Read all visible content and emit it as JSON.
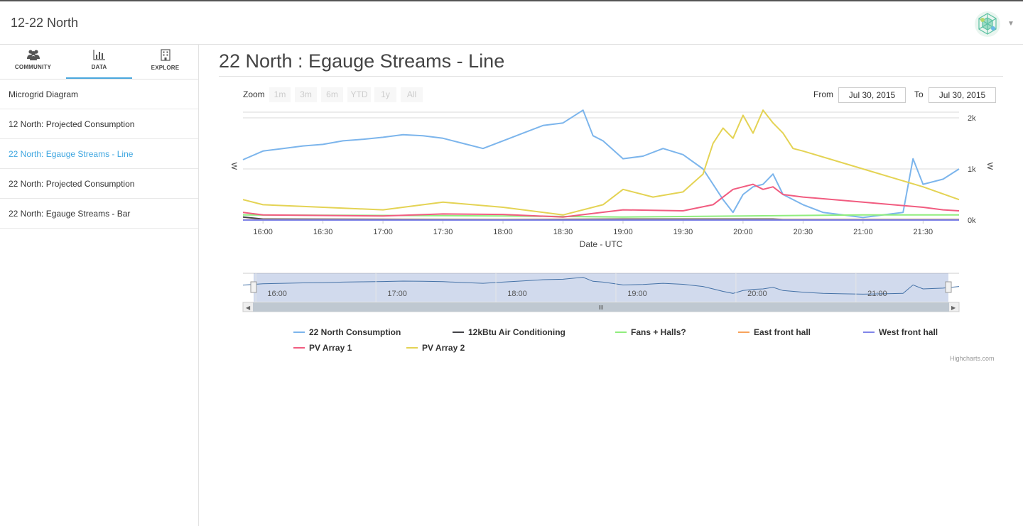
{
  "app": {
    "title": "12-22 North"
  },
  "tabs": [
    {
      "label": "COMMUNITY",
      "icon": "community-icon"
    },
    {
      "label": "DATA",
      "icon": "bar-chart-icon"
    },
    {
      "label": "EXPLORE",
      "icon": "building-icon"
    }
  ],
  "nav": [
    {
      "label": "Microgrid Diagram"
    },
    {
      "label": "12 North: Projected Consumption"
    },
    {
      "label": "22 North: Egauge Streams - Line"
    },
    {
      "label": "22 North: Projected Consumption"
    },
    {
      "label": "22 North: Egauge Streams - Bar"
    }
  ],
  "page": {
    "title": "22 North : Egauge Streams - Line"
  },
  "range_selector": {
    "zoom_label": "Zoom",
    "buttons": [
      "1m",
      "3m",
      "6m",
      "YTD",
      "1y",
      "All"
    ],
    "from_label": "From",
    "from_value": "Jul 30, 2015",
    "to_label": "To",
    "to_value": "Jul 30, 2015"
  },
  "credits": "Highcharts.com",
  "colors": {
    "consumption": "#7cb5ec",
    "ac": "#434348",
    "fans": "#90ed7d",
    "east": "#f7a35c",
    "west": "#8085e9",
    "pv1": "#f15c80",
    "pv2": "#e4d354",
    "accent": "#3ea6e0"
  },
  "chart_data": {
    "type": "line",
    "xlabel": "Date - UTC",
    "ylabel_left": "W",
    "ylabel_right": "W",
    "x_ticks": [
      "16:00",
      "16:30",
      "17:00",
      "17:30",
      "18:00",
      "18:30",
      "19:00",
      "19:30",
      "20:00",
      "20:30",
      "21:00",
      "21:30"
    ],
    "y_ticks": [
      "0k",
      "1k",
      "2k"
    ],
    "ylim": [
      0,
      2000
    ],
    "xlim": [
      "15:50",
      "21:48"
    ],
    "navigator_ticks": [
      "16:00",
      "17:00",
      "18:00",
      "19:00",
      "20:00",
      "21:00"
    ],
    "series": [
      {
        "name": "22 North Consumption",
        "color": "#7cb5ec",
        "x": [
          "15:50",
          "16:00",
          "16:10",
          "16:20",
          "16:30",
          "16:40",
          "16:50",
          "17:00",
          "17:10",
          "17:20",
          "17:30",
          "17:40",
          "17:50",
          "18:00",
          "18:10",
          "18:20",
          "18:30",
          "18:40",
          "18:45",
          "18:50",
          "19:00",
          "19:10",
          "19:20",
          "19:30",
          "19:40",
          "19:45",
          "19:50",
          "19:55",
          "20:00",
          "20:05",
          "20:10",
          "20:15",
          "20:20",
          "20:30",
          "20:40",
          "20:50",
          "21:00",
          "21:10",
          "21:20",
          "21:25",
          "21:30",
          "21:40",
          "21:48"
        ],
        "values": [
          1180,
          1350,
          1400,
          1450,
          1480,
          1550,
          1580,
          1620,
          1670,
          1650,
          1600,
          1500,
          1400,
          1550,
          1700,
          1850,
          1900,
          2150,
          1650,
          1550,
          1200,
          1250,
          1400,
          1280,
          1000,
          700,
          400,
          150,
          500,
          650,
          700,
          900,
          500,
          300,
          150,
          100,
          50,
          100,
          150,
          1200,
          700,
          800,
          1000
        ]
      },
      {
        "name": "12kBtu Air Conditioning",
        "color": "#434348",
        "x": [
          "15:50",
          "16:00",
          "18:00",
          "19:00",
          "20:15",
          "20:20",
          "21:48"
        ],
        "values": [
          60,
          20,
          10,
          20,
          20,
          10,
          10
        ]
      },
      {
        "name": "Fans + Halls?",
        "color": "#90ed7d",
        "x": [
          "15:50",
          "17:00",
          "18:00",
          "19:00",
          "20:00",
          "21:00",
          "21:48"
        ],
        "values": [
          100,
          90,
          80,
          60,
          80,
          100,
          100
        ]
      },
      {
        "name": "East front hall",
        "color": "#f7a35c",
        "x": [
          "15:50",
          "21:48"
        ],
        "values": [
          5,
          5
        ]
      },
      {
        "name": "West front hall",
        "color": "#8085e9",
        "x": [
          "15:50",
          "21:48"
        ],
        "values": [
          0,
          0
        ]
      },
      {
        "name": "PV Array 1",
        "color": "#f15c80",
        "x": [
          "15:50",
          "16:00",
          "17:00",
          "17:30",
          "18:00",
          "18:30",
          "19:00",
          "19:30",
          "19:45",
          "19:55",
          "20:00",
          "20:05",
          "20:10",
          "20:15",
          "20:20",
          "20:30",
          "21:00",
          "21:30",
          "21:40",
          "21:48"
        ],
        "values": [
          150,
          100,
          80,
          120,
          110,
          60,
          200,
          180,
          300,
          600,
          650,
          700,
          600,
          650,
          500,
          450,
          350,
          250,
          200,
          180
        ]
      },
      {
        "name": "PV Array 2",
        "color": "#e4d354",
        "x": [
          "15:50",
          "16:00",
          "16:30",
          "17:00",
          "17:30",
          "18:00",
          "18:30",
          "18:50",
          "19:00",
          "19:15",
          "19:30",
          "19:40",
          "19:45",
          "19:50",
          "19:55",
          "20:00",
          "20:05",
          "20:10",
          "20:15",
          "20:20",
          "20:25",
          "20:30",
          "21:00",
          "21:30",
          "21:48"
        ],
        "values": [
          400,
          300,
          250,
          200,
          350,
          250,
          100,
          300,
          600,
          450,
          550,
          900,
          1500,
          1800,
          1600,
          2050,
          1700,
          2150,
          1900,
          1700,
          1400,
          1350,
          1000,
          650,
          400
        ]
      }
    ]
  }
}
